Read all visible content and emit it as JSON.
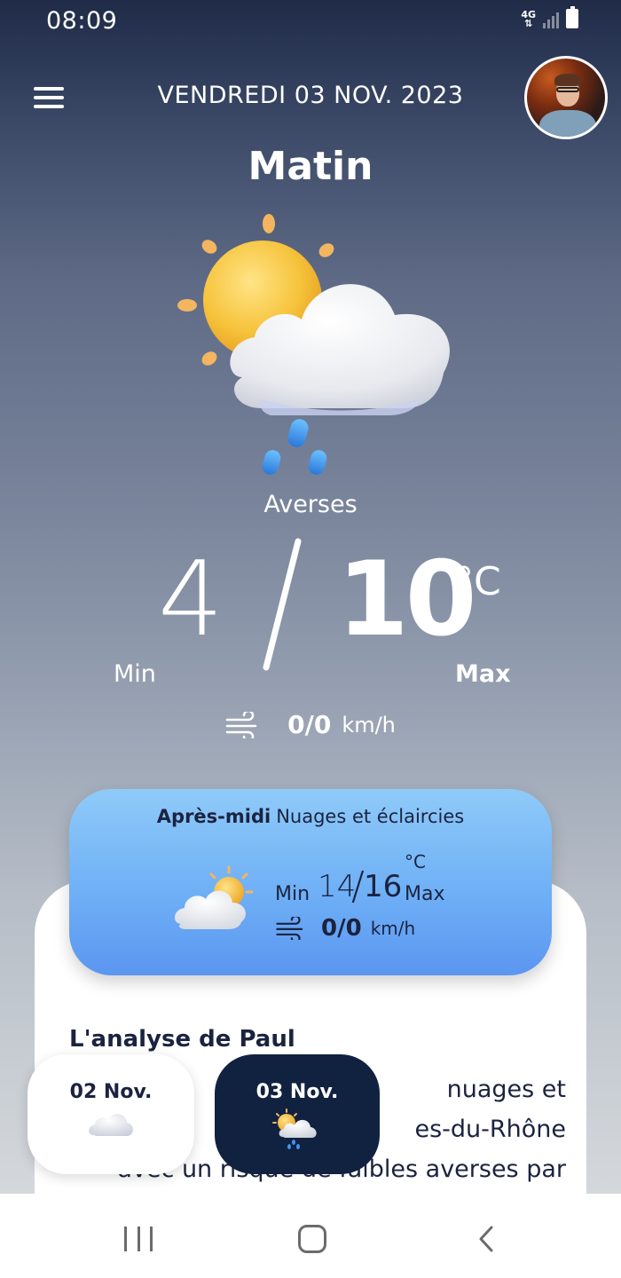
{
  "status_bar": {
    "time": "08:09",
    "network": "4G"
  },
  "header": {
    "date": "VENDREDI 03 NOV. 2023",
    "menu_icon": "hamburger-menu-icon",
    "avatar": "profile-avatar"
  },
  "main": {
    "period": "Matin",
    "icon": "sun-cloud-rain-icon",
    "condition": "Averses",
    "temp_min": "4",
    "temp_max": "10",
    "unit": "°C",
    "min_label": "Min",
    "max_label": "Max",
    "wind_value": "0/0",
    "wind_unit": "km/h"
  },
  "afternoon": {
    "period": "Après-midi",
    "condition": "Nuages et éclaircies",
    "icon": "sun-cloud-icon",
    "min_label": "Min",
    "temp_min": "14",
    "temp_max": "16",
    "unit": "°C",
    "max_label": "Max",
    "wind_value": "0/0",
    "wind_unit": "km/h"
  },
  "analysis": {
    "title": "L'analyse de Paul",
    "lines": [
      "nuages et",
      "es-du-Rhône",
      "avec un risque de faibles averses par"
    ]
  },
  "day_tabs": [
    {
      "label": "02 Nov.",
      "icon": "cloud-icon",
      "active": false
    },
    {
      "label": "03 Nov.",
      "icon": "sun-cloud-rain-icon",
      "active": true
    }
  ],
  "colors": {
    "accent_dark": "#10223f",
    "card_blue": "#6fb0f6",
    "text_dark": "#1b2340"
  }
}
